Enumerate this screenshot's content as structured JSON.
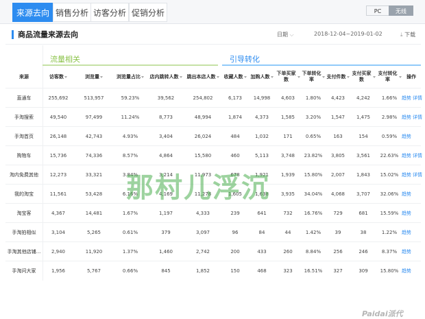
{
  "tabs": [
    {
      "label": "来源去向",
      "active": true
    },
    {
      "label": "销售分析",
      "active": false
    },
    {
      "label": "访客分析",
      "active": false
    },
    {
      "label": "促销分析",
      "active": false
    }
  ],
  "device_switch": {
    "pc": "PC",
    "wireless": "无线",
    "selected": "无线"
  },
  "section": {
    "title": "商品流量来源去向",
    "period_label": "日期",
    "date_range": "2018-12-04~2019-01-02",
    "download": "下载"
  },
  "groups": {
    "traffic": "流量相关",
    "conversion": "引导转化"
  },
  "headers": [
    "来源",
    "访客数",
    "浏览量",
    "浏览量占比",
    "店内跳转人数",
    "跳出本店人数",
    "收藏人数",
    "加购人数",
    "下单买家数",
    "下单转化率",
    "支付件数",
    "支付买家数",
    "支付转化率",
    "操作"
  ],
  "rows": [
    {
      "source": "直通车",
      "vals": [
        "255,692",
        "513,957",
        "59.23%",
        "39,562",
        "254,802",
        "6,173",
        "14,998",
        "4,603",
        "1.80%",
        "4,423",
        "4,242",
        "1.66%"
      ],
      "actions": [
        "趋势",
        "详情"
      ]
    },
    {
      "source": "手淘搜索",
      "vals": [
        "49,540",
        "97,499",
        "11.24%",
        "8,773",
        "48,994",
        "1,874",
        "4,373",
        "1,585",
        "3.20%",
        "1,547",
        "1,475",
        "2.98%"
      ],
      "actions": [
        "趋势",
        "详情"
      ]
    },
    {
      "source": "手淘首页",
      "vals": [
        "26,148",
        "42,743",
        "4.93%",
        "3,404",
        "26,024",
        "484",
        "1,032",
        "171",
        "0.65%",
        "163",
        "154",
        "0.59%"
      ],
      "actions": [
        "趋势"
      ]
    },
    {
      "source": "购物车",
      "vals": [
        "15,736",
        "74,336",
        "8.57%",
        "4,864",
        "15,580",
        "460",
        "5,113",
        "3,748",
        "23.82%",
        "3,805",
        "3,561",
        "22.63%"
      ],
      "actions": [
        "趋势",
        "详情"
      ]
    },
    {
      "source": "淘内免费其他",
      "vals": [
        "12,273",
        "33,321",
        "3.84%",
        "3,214",
        "11,973",
        "678",
        "1,921",
        "1,939",
        "15.80%",
        "2,007",
        "1,843",
        "15.02%"
      ],
      "actions": [
        "趋势",
        "详情"
      ]
    },
    {
      "source": "我的淘宝",
      "vals": [
        "11,561",
        "53,428",
        "6.16%",
        "4,169",
        "11,278",
        "1,605",
        "1,638",
        "3,935",
        "34.04%",
        "4,068",
        "3,707",
        "32.06%"
      ],
      "actions": [
        "趋势"
      ]
    },
    {
      "source": "淘宝客",
      "vals": [
        "4,367",
        "14,481",
        "1.67%",
        "1,197",
        "4,333",
        "239",
        "641",
        "732",
        "16.76%",
        "729",
        "681",
        "15.59%"
      ],
      "actions": [
        "趋势"
      ]
    },
    {
      "source": "手淘拍相似",
      "vals": [
        "3,104",
        "5,265",
        "0.61%",
        "379",
        "3,097",
        "96",
        "84",
        "44",
        "1.42%",
        "39",
        "38",
        "1.22%"
      ],
      "actions": [
        "趋势"
      ]
    },
    {
      "source": "手淘其他店铺...",
      "vals": [
        "2,940",
        "11,920",
        "1.37%",
        "1,460",
        "2,742",
        "200",
        "433",
        "260",
        "8.84%",
        "256",
        "246",
        "8.37%"
      ],
      "actions": [
        "趋势"
      ]
    },
    {
      "source": "手淘问大家",
      "vals": [
        "1,956",
        "5,767",
        "0.66%",
        "845",
        "1,852",
        "150",
        "468",
        "323",
        "16.51%",
        "327",
        "309",
        "15.80%"
      ],
      "actions": [
        "趋势"
      ]
    }
  ],
  "watermark": "那村儿浮沉",
  "logo": "Paidai派代"
}
